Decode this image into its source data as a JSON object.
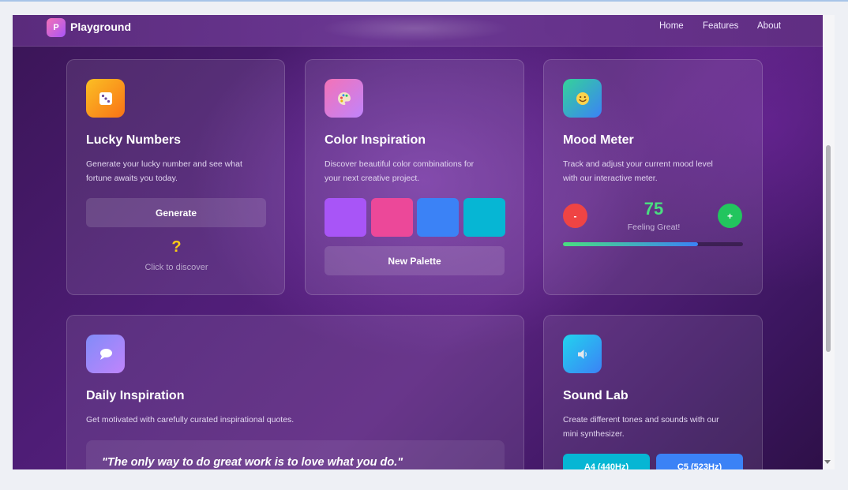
{
  "nav": {
    "brand_letter": "P",
    "brand": "Playground",
    "links": [
      "Home",
      "Features",
      "About"
    ]
  },
  "cards": {
    "lucky": {
      "icon": "dice-icon",
      "title": "Lucky Numbers",
      "desc_line1": "Generate your lucky number and see what",
      "desc_line2": "fortune awaits you today.",
      "button": "Generate",
      "result": "?",
      "hint": "Click to discover"
    },
    "color": {
      "icon": "palette-icon",
      "title": "Color Inspiration",
      "desc_line1": "Discover beautiful color combinations for",
      "desc_line2": "your next creative project.",
      "swatches": [
        "#a855f7",
        "#ec4899",
        "#3b82f6",
        "#06b6d4"
      ],
      "button": "New Palette"
    },
    "mood": {
      "icon": "smiley-icon",
      "title": "Mood Meter",
      "desc_line1": "Track and adjust your current mood level",
      "desc_line2": "with our interactive meter.",
      "minus": "-",
      "plus": "+",
      "value": "75",
      "status": "Feeling Great!",
      "level": 0.75
    },
    "inspiration": {
      "icon": "speech-bubble-icon",
      "title": "Daily Inspiration",
      "desc": "Get motivated with carefully curated inspirational quotes.",
      "quote": "\"The only way to do great work is to love what you do.\""
    },
    "sound": {
      "icon": "speaker-icon",
      "title": "Sound Lab",
      "desc_line1": "Create different tones and sounds with our",
      "desc_line2": "mini synthesizer.",
      "buttons": [
        "A4 (440Hz)",
        "C5 (523Hz)"
      ]
    }
  },
  "colors": {
    "accent_green": "#4ade80",
    "minus_red": "#ef4444",
    "plus_green": "#22c55e",
    "result_yellow": "#facc15"
  }
}
